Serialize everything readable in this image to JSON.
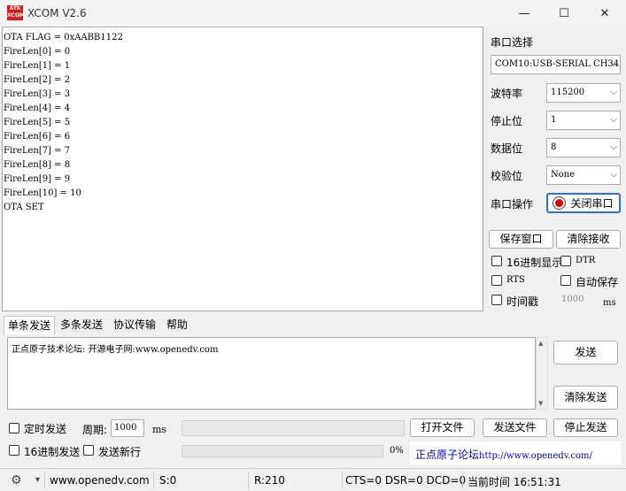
{
  "window": {
    "logo_text": "ATK XCOM",
    "title": "XCOM V2.6",
    "minimize": "—",
    "maximize": "☐",
    "close": "✕"
  },
  "receive": {
    "lines": [
      "OTA FLAG = 0xAABB1122",
      "FireLen[0] = 0",
      "FireLen[1] = 1",
      "FireLen[2] = 2",
      "FireLen[3] = 3",
      "FireLen[4] = 4",
      "FireLen[5] = 5",
      "FireLen[6] = 6",
      "FireLen[7] = 7",
      "FireLen[8] = 8",
      "FireLen[9] = 9",
      "FireLen[10] = 10",
      "OTA SET"
    ]
  },
  "port": {
    "select_label": "串口选择",
    "port_value": "COM10:USB-SERIAL CH34",
    "baud_label": "波特率",
    "baud_value": "115200",
    "stopbit_label": "停止位",
    "stopbit_value": "1",
    "databit_label": "数据位",
    "databit_value": "8",
    "parity_label": "校验位",
    "parity_value": "None",
    "op_label": "串口操作",
    "close_port_label": "关闭串口",
    "save_window_label": "保存窗口",
    "clear_recv_label": "清除接收",
    "hex_display_label": "16进制显示",
    "dtr_label": "DTR",
    "rts_label": "RTS",
    "autosave_label": "自动保存",
    "timestamp_label": "时间戳",
    "timestamp_value": "1000",
    "timestamp_unit": "ms"
  },
  "tabs": [
    "单条发送",
    "多条发送",
    "协议传输",
    "帮助"
  ],
  "send": {
    "text": "正点原子技术论坛: 开源电子网:www.openedv.com",
    "send_label": "发送",
    "clear_send_label": "清除发送",
    "timed_send_label": "定时发送",
    "period_label": "周期:",
    "period_value": "1000",
    "period_unit": "ms",
    "hex_send_label": "16进制发送",
    "send_newline_label": "发送新行",
    "progress_text": "0%",
    "progress": 0,
    "open_file_label": "打开文件",
    "send_file_label": "发送文件",
    "stop_send_label": "停止发送",
    "forum_prefix": "正点原子论坛",
    "forum_url": "http://www.openedv.com/"
  },
  "status": {
    "website": "www.openedv.com",
    "sent": "S:0",
    "received": "R:210",
    "signals": "CTS=0 DSR=0 DCD=0",
    "time": "当前时间 16:51:31"
  },
  "colors": {
    "record_red": "#e00000",
    "link_blue": "#0000cc"
  }
}
